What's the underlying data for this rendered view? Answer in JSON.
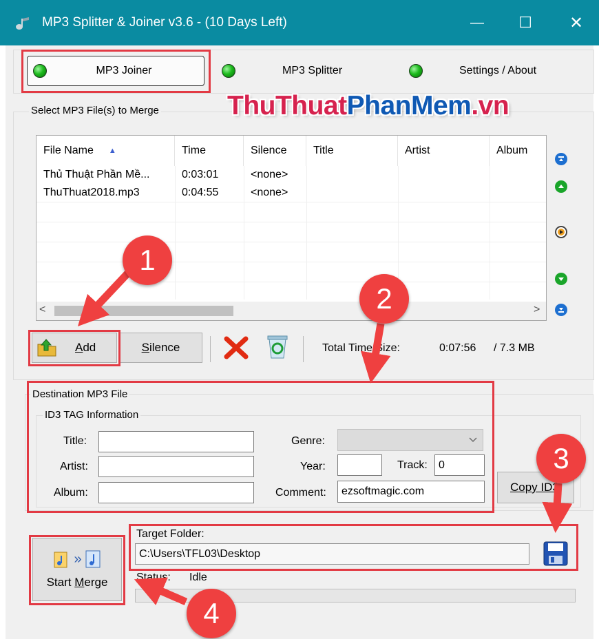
{
  "window": {
    "title": "MP3 Splitter & Joiner v3.6 - (10 Days Left)",
    "minimize_glyph": "—",
    "maximize_glyph": "☐",
    "close_glyph": "✕"
  },
  "tabs": [
    {
      "label": "MP3 Joiner",
      "active": true
    },
    {
      "label": "MP3 Splitter",
      "active": false
    },
    {
      "label": "Settings / About",
      "active": false
    }
  ],
  "watermark": {
    "part1": "ThuThuat",
    "part2": "PhanMem",
    "part3": ".vn",
    "color1": "#d6224e",
    "color2": "#0f59b4"
  },
  "select_group": {
    "legend": "Select MP3 File(s) to Merge"
  },
  "file_list": {
    "sort_indicator": "▲",
    "columns": [
      "File Name",
      "Time",
      "Silence",
      "Title",
      "Artist",
      "Album"
    ],
    "rows": [
      {
        "file_name": "Thủ Thuật Phần Mề...",
        "time": "0:03:01",
        "silence": "<none>"
      },
      {
        "file_name": "ThuThuat2018.mp3",
        "time": "0:04:55",
        "silence": "<none>"
      }
    ],
    "scroll_left": "<",
    "scroll_right": ">"
  },
  "side_buttons": [
    "move-top-icon",
    "move-up-icon",
    "play-icon",
    "move-down-icon",
    "move-bottom-icon"
  ],
  "toolbar": {
    "add_label": "Add",
    "add_mnemonic": "A",
    "silence_label": "Silence",
    "silence_mnemonic": "S",
    "total_label": "Total Time/Size:",
    "total_time": "0:07:56",
    "total_size": "/ 7.3 MB"
  },
  "destination": {
    "legend": "Destination MP3 File",
    "id3_legend": "ID3 TAG Information",
    "title_label": "Title:",
    "title_value": "",
    "artist_label": "Artist:",
    "artist_value": "",
    "album_label": "Album:",
    "album_value": "",
    "genre_label": "Genre:",
    "genre_value": "",
    "year_label": "Year:",
    "year_value": "",
    "track_label": "Track:",
    "track_value": "0",
    "comment_label": "Comment:",
    "comment_value": "ezsoftmagic.com",
    "copy_id3_label": "Copy ID3"
  },
  "target": {
    "label": "Target Folder:",
    "path": "C:\\Users\\TFL03\\Desktop",
    "status_label": "Status:",
    "status_value": "Idle"
  },
  "merge": {
    "label_pre": "Start ",
    "label_mnemonic": "M",
    "label_post": "erge",
    "arrow": "»"
  },
  "annotations": [
    "1",
    "2",
    "3",
    "4"
  ],
  "colors": {
    "titlebar": "#0a8ba1",
    "highlight": "#e23a44",
    "badge": "#ef4040"
  }
}
